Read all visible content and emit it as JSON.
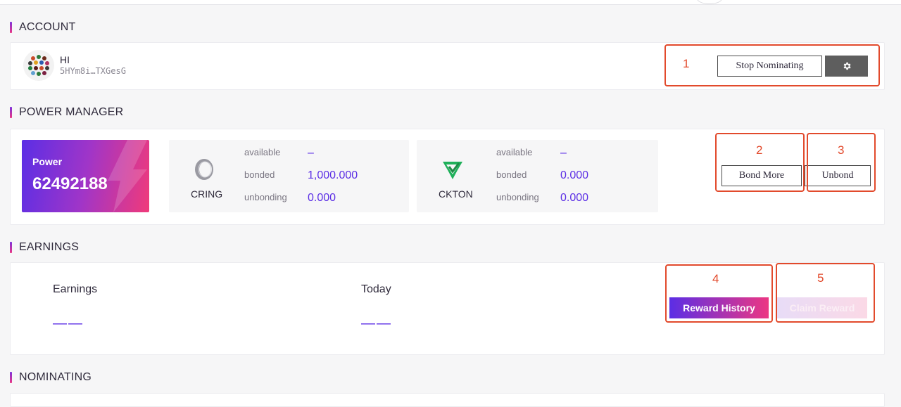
{
  "account": {
    "section_title": "ACCOUNT",
    "name": "HI",
    "address": "5HYm8i…TXGesG",
    "stop_nominating_label": "Stop Nominating",
    "settings_icon": "gear-icon"
  },
  "power_manager": {
    "section_title": "POWER MANAGER",
    "power_label": "Power",
    "power_value": "62492188",
    "tokens": [
      {
        "symbol": "CRING",
        "icon": "ring-icon",
        "available_label": "available",
        "available": "–",
        "bonded_label": "bonded",
        "bonded": "1,000.000",
        "unbonding_label": "unbonding",
        "unbonding": "0.000"
      },
      {
        "symbol": "CKTON",
        "icon": "kton-icon",
        "available_label": "available",
        "available": "–",
        "bonded_label": "bonded",
        "bonded": "0.000",
        "unbonding_label": "unbonding",
        "unbonding": "0.000"
      }
    ],
    "bond_more_label": "Bond More",
    "unbond_label": "Unbond"
  },
  "earnings": {
    "section_title": "EARNINGS",
    "earnings_label": "Earnings",
    "earnings_value": "——",
    "today_label": "Today",
    "today_value": "——",
    "reward_history_label": "Reward History",
    "claim_reward_label": "Claim Reward"
  },
  "nominating": {
    "section_title": "NOMINATING"
  },
  "annotations": [
    "1",
    "2",
    "3",
    "4",
    "5"
  ],
  "colors": {
    "accent": "#5b2ee5",
    "accent_end": "#ec3783",
    "annotation": "#e24a2c"
  }
}
